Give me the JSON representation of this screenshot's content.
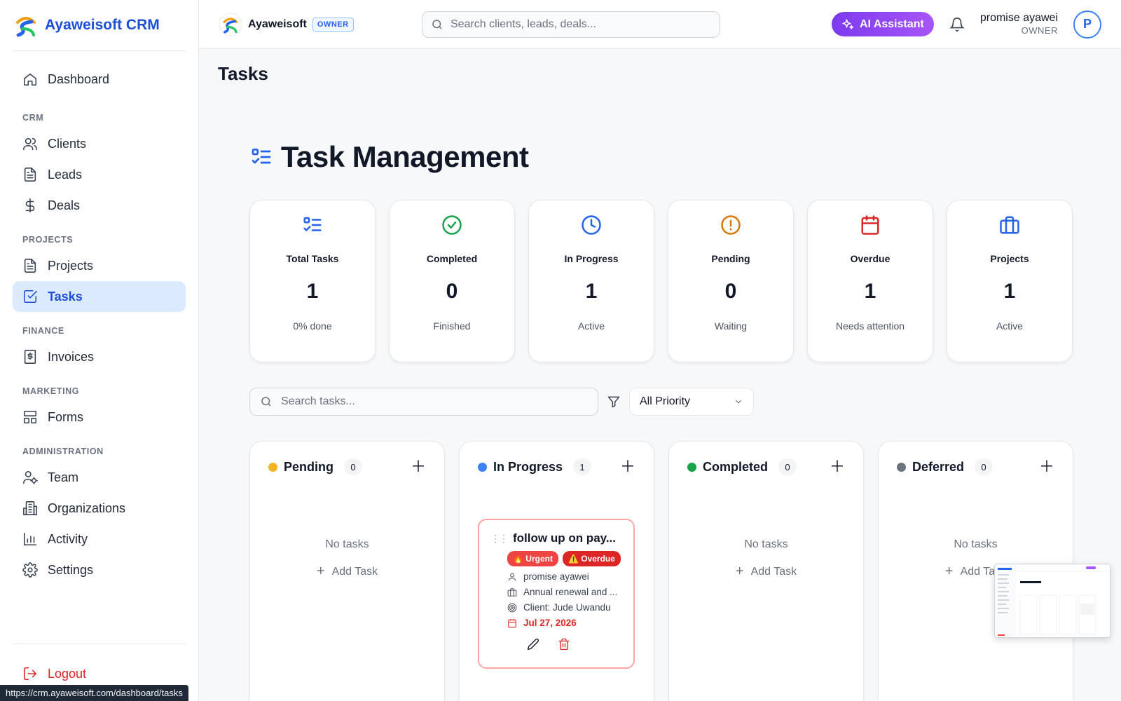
{
  "brand": {
    "name": "Ayaweisoft CRM"
  },
  "sidebar": {
    "dashboard": "Dashboard",
    "sections": {
      "crm": "CRM",
      "projects": "PROJECTS",
      "finance": "FINANCE",
      "marketing": "MARKETING",
      "administration": "ADMINISTRATION"
    },
    "items": {
      "clients": "Clients",
      "leads": "Leads",
      "deals": "Deals",
      "projects": "Projects",
      "tasks": "Tasks",
      "invoices": "Invoices",
      "forms": "Forms",
      "team": "Team",
      "organizations": "Organizations",
      "activity": "Activity",
      "settings": "Settings"
    },
    "active": "tasks",
    "logout": "Logout"
  },
  "status_url": "https://crm.ayaweisoft.com/dashboard/tasks",
  "topbar": {
    "org_name": "Ayaweisoft",
    "org_badge": "OWNER",
    "search_placeholder": "Search clients, leads, deals...",
    "ai_button": "AI Assistant",
    "user_name": "promise ayawei",
    "user_role": "OWNER",
    "avatar_initial": "P"
  },
  "page": {
    "title": "Tasks",
    "heading": "Task Management"
  },
  "stats": [
    {
      "label": "Total Tasks",
      "value": "1",
      "sub": "0% done",
      "icon": "list-checks-icon",
      "color": "#2563eb"
    },
    {
      "label": "Completed",
      "value": "0",
      "sub": "Finished",
      "icon": "check-circle-icon",
      "color": "#16a34a"
    },
    {
      "label": "In Progress",
      "value": "1",
      "sub": "Active",
      "icon": "clock-icon",
      "color": "#2563eb"
    },
    {
      "label": "Pending",
      "value": "0",
      "sub": "Waiting",
      "icon": "alert-circle-icon",
      "color": "#d97706"
    },
    {
      "label": "Overdue",
      "value": "1",
      "sub": "Needs attention",
      "icon": "calendar-icon",
      "color": "#dc2626"
    },
    {
      "label": "Projects",
      "value": "1",
      "sub": "Active",
      "icon": "briefcase-icon",
      "color": "#2563eb"
    }
  ],
  "filters": {
    "search_placeholder": "Search tasks...",
    "priority": "All Priority"
  },
  "columns": [
    {
      "title": "Pending",
      "count": "0",
      "color": "#f5b324",
      "empty": "No tasks",
      "add": "Add Task"
    },
    {
      "title": "In Progress",
      "count": "1",
      "color": "#3b82f6",
      "empty": "",
      "add": ""
    },
    {
      "title": "Completed",
      "count": "0",
      "color": "#16a34a",
      "empty": "No tasks",
      "add": "Add Task"
    },
    {
      "title": "Deferred",
      "count": "0",
      "color": "#6b7280",
      "empty": "No tasks",
      "add": "Add Task"
    }
  ],
  "task": {
    "title": "follow up on pay...",
    "badge_urgent": "🔥 Urgent",
    "badge_overdue": "⚠️ Overdue",
    "assignee": "promise ayawei",
    "project": "Annual renewal and ...",
    "client": "Client: Jude Uwandu",
    "due": "Jul 27, 2026"
  }
}
